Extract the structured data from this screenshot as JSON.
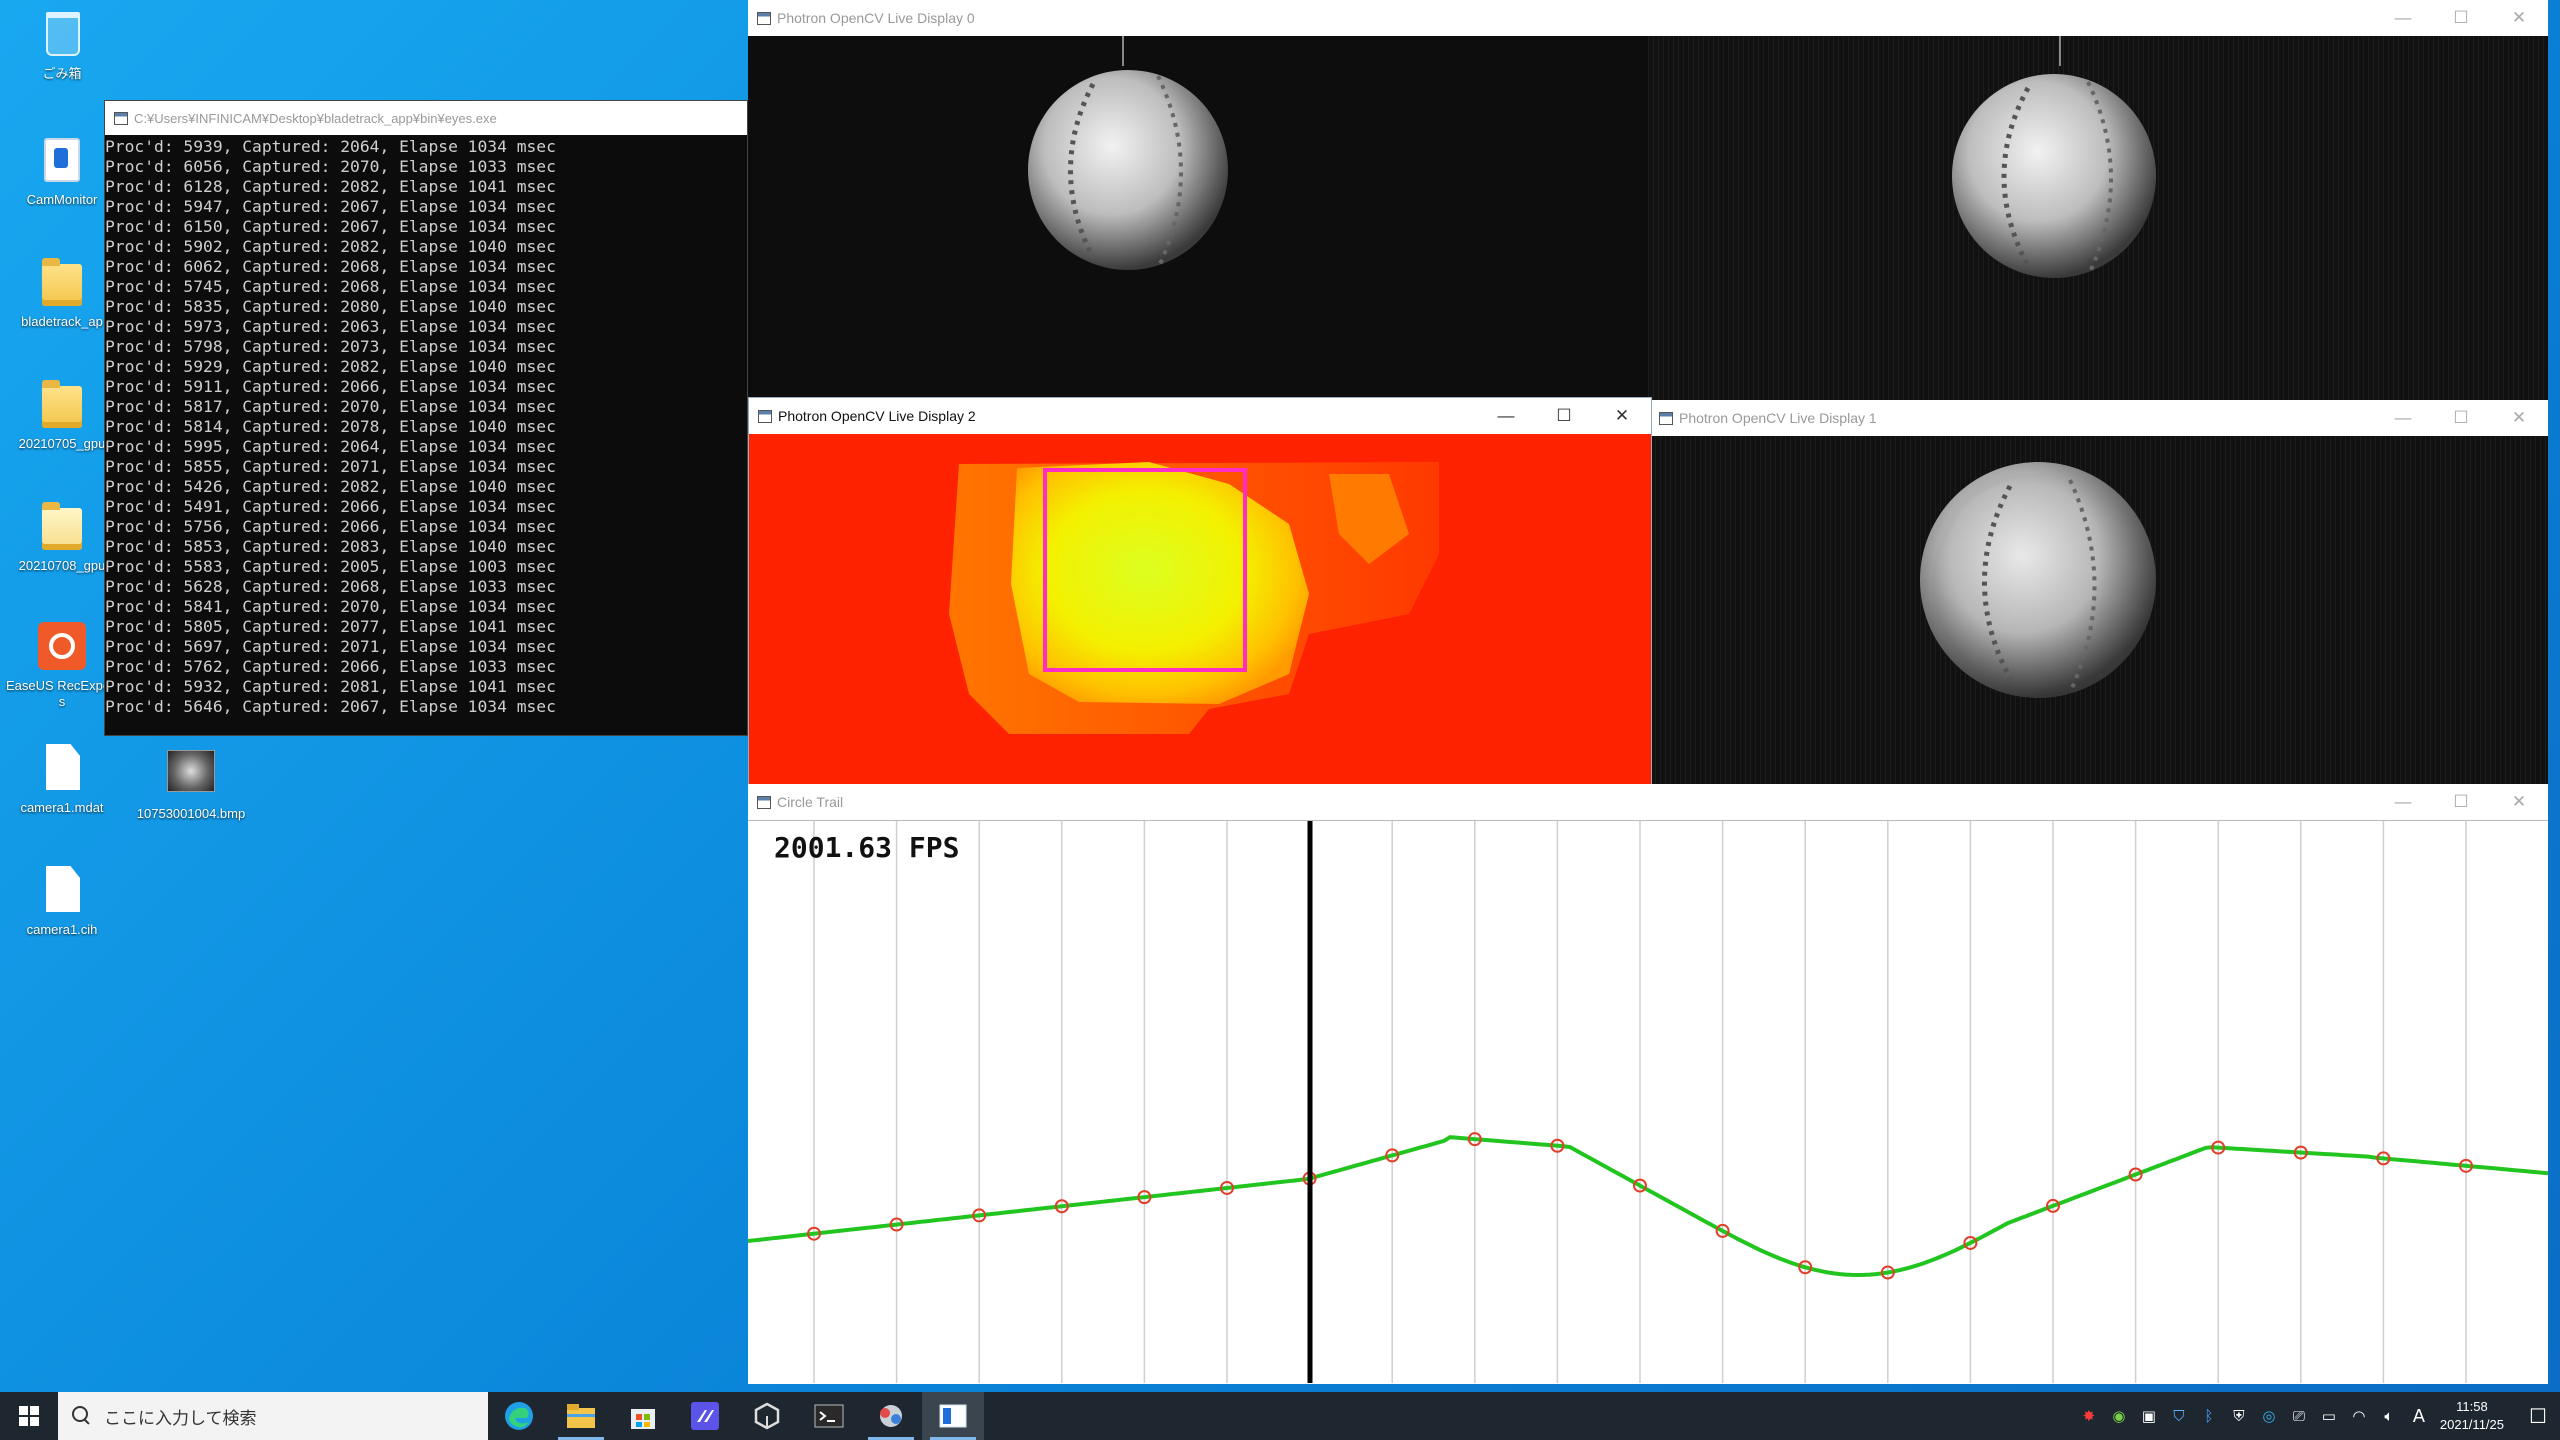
{
  "desktop": {
    "icons": [
      {
        "label": "ごみ箱",
        "icon": "recycle-bin-icon"
      },
      {
        "label": "CamMonitor",
        "icon": "app-icon"
      },
      {
        "label": "bladetrack_ap",
        "icon": "folder-icon"
      },
      {
        "label": "20210705_gpu",
        "icon": "folder-icon"
      },
      {
        "label": "20210708_gpu",
        "icon": "folder-icon"
      },
      {
        "label": "EaseUS RecExperts",
        "icon": "easeus-icon"
      },
      {
        "label": "camera1.mdat",
        "icon": "file-icon"
      },
      {
        "label": "10753001004.bmp",
        "icon": "image-icon"
      },
      {
        "label": "camera1.cih",
        "icon": "file-icon"
      }
    ]
  },
  "console": {
    "title": "C:¥Users¥INFINICAM¥Desktop¥bladetrack_app¥bin¥eyes.exe",
    "lines": [
      "Proc'd: 5939, Captured: 2064, Elapse 1034 msec",
      "Proc'd: 6056, Captured: 2070, Elapse 1033 msec",
      "Proc'd: 6128, Captured: 2082, Elapse 1041 msec",
      "Proc'd: 5947, Captured: 2067, Elapse 1034 msec",
      "Proc'd: 6150, Captured: 2067, Elapse 1034 msec",
      "Proc'd: 5902, Captured: 2082, Elapse 1040 msec",
      "Proc'd: 6062, Captured: 2068, Elapse 1034 msec",
      "Proc'd: 5745, Captured: 2068, Elapse 1034 msec",
      "Proc'd: 5835, Captured: 2080, Elapse 1040 msec",
      "Proc'd: 5973, Captured: 2063, Elapse 1034 msec",
      "Proc'd: 5798, Captured: 2073, Elapse 1034 msec",
      "Proc'd: 5929, Captured: 2082, Elapse 1040 msec",
      "Proc'd: 5911, Captured: 2066, Elapse 1034 msec",
      "Proc'd: 5817, Captured: 2070, Elapse 1034 msec",
      "Proc'd: 5814, Captured: 2078, Elapse 1040 msec",
      "Proc'd: 5995, Captured: 2064, Elapse 1034 msec",
      "Proc'd: 5855, Captured: 2071, Elapse 1034 msec",
      "Proc'd: 5426, Captured: 2082, Elapse 1040 msec",
      "Proc'd: 5491, Captured: 2066, Elapse 1034 msec",
      "Proc'd: 5756, Captured: 2066, Elapse 1034 msec",
      "Proc'd: 5853, Captured: 2083, Elapse 1040 msec",
      "Proc'd: 5583, Captured: 2005, Elapse 1003 msec",
      "Proc'd: 5628, Captured: 2068, Elapse 1033 msec",
      "Proc'd: 5841, Captured: 2070, Elapse 1034 msec",
      "Proc'd: 5805, Captured: 2077, Elapse 1041 msec",
      "Proc'd: 5697, Captured: 2071, Elapse 1034 msec",
      "Proc'd: 5762, Captured: 2066, Elapse 1033 msec",
      "Proc'd: 5932, Captured: 2081, Elapse 1041 msec",
      "Proc'd: 5646, Captured: 2067, Elapse 1034 msec"
    ]
  },
  "display0": {
    "title": "Photron OpenCV Live Display 0"
  },
  "display1": {
    "title": "Photron OpenCV Live Display 1"
  },
  "display2": {
    "title": "Photron OpenCV Live Display 2"
  },
  "trail": {
    "title": "Circle Trail",
    "fps": "2001.63 FPS"
  },
  "window_controls": {
    "minimize": "—",
    "maximize": "☐",
    "close": "✕"
  },
  "taskbar": {
    "search_placeholder": "ここに入力して検索",
    "apps": [
      {
        "name": "edge",
        "active": false
      },
      {
        "name": "file-explorer",
        "active": false
      },
      {
        "name": "store",
        "active": false
      },
      {
        "name": "visual-studio",
        "active": false
      },
      {
        "name": "unity",
        "active": false
      },
      {
        "name": "terminal",
        "active": false
      },
      {
        "name": "opencv-app",
        "active": false
      },
      {
        "name": "display-window",
        "active": true
      }
    ],
    "ime": "A",
    "time": "11:58",
    "date": "2021/11/25"
  },
  "colors": {
    "desktop_blue": "#0a84d8",
    "heatmap_bg": "#ff2200",
    "roi_box": "#ff2cc8",
    "trail_line": "#22c51f",
    "trail_marker": "#e0402a"
  }
}
